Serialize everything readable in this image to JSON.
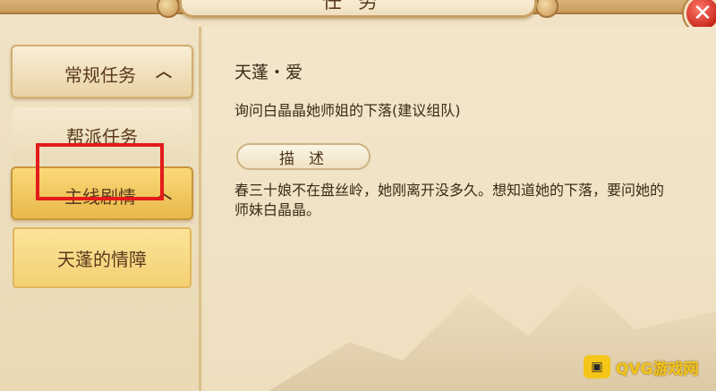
{
  "window": {
    "title": "任务",
    "close_symbol": "✕"
  },
  "sidebar": {
    "categories": [
      {
        "label": "常规任务",
        "expanded_icon": "chevron-up"
      },
      {
        "label": "主线剧情",
        "expanded_icon": "chevron-up"
      }
    ],
    "subitems": [
      {
        "label": "帮派任务"
      },
      {
        "label": "天蓬的情障",
        "selected": true
      }
    ]
  },
  "quest": {
    "title": "天蓬・爱",
    "goal": "询问白晶晶她师姐的下落(建议组队)",
    "desc_tab_label": "描述",
    "description": "春三十娘不在盘丝岭，她刚离开没多久。想知道她的下落，要问她的师妹白晶晶。"
  },
  "watermark": {
    "icon_text": "▣",
    "text": "QVG游戏网"
  },
  "colors": {
    "highlight": "#e41b1b",
    "selected_bg": "#f4d073",
    "close_red": "#c8281c"
  }
}
